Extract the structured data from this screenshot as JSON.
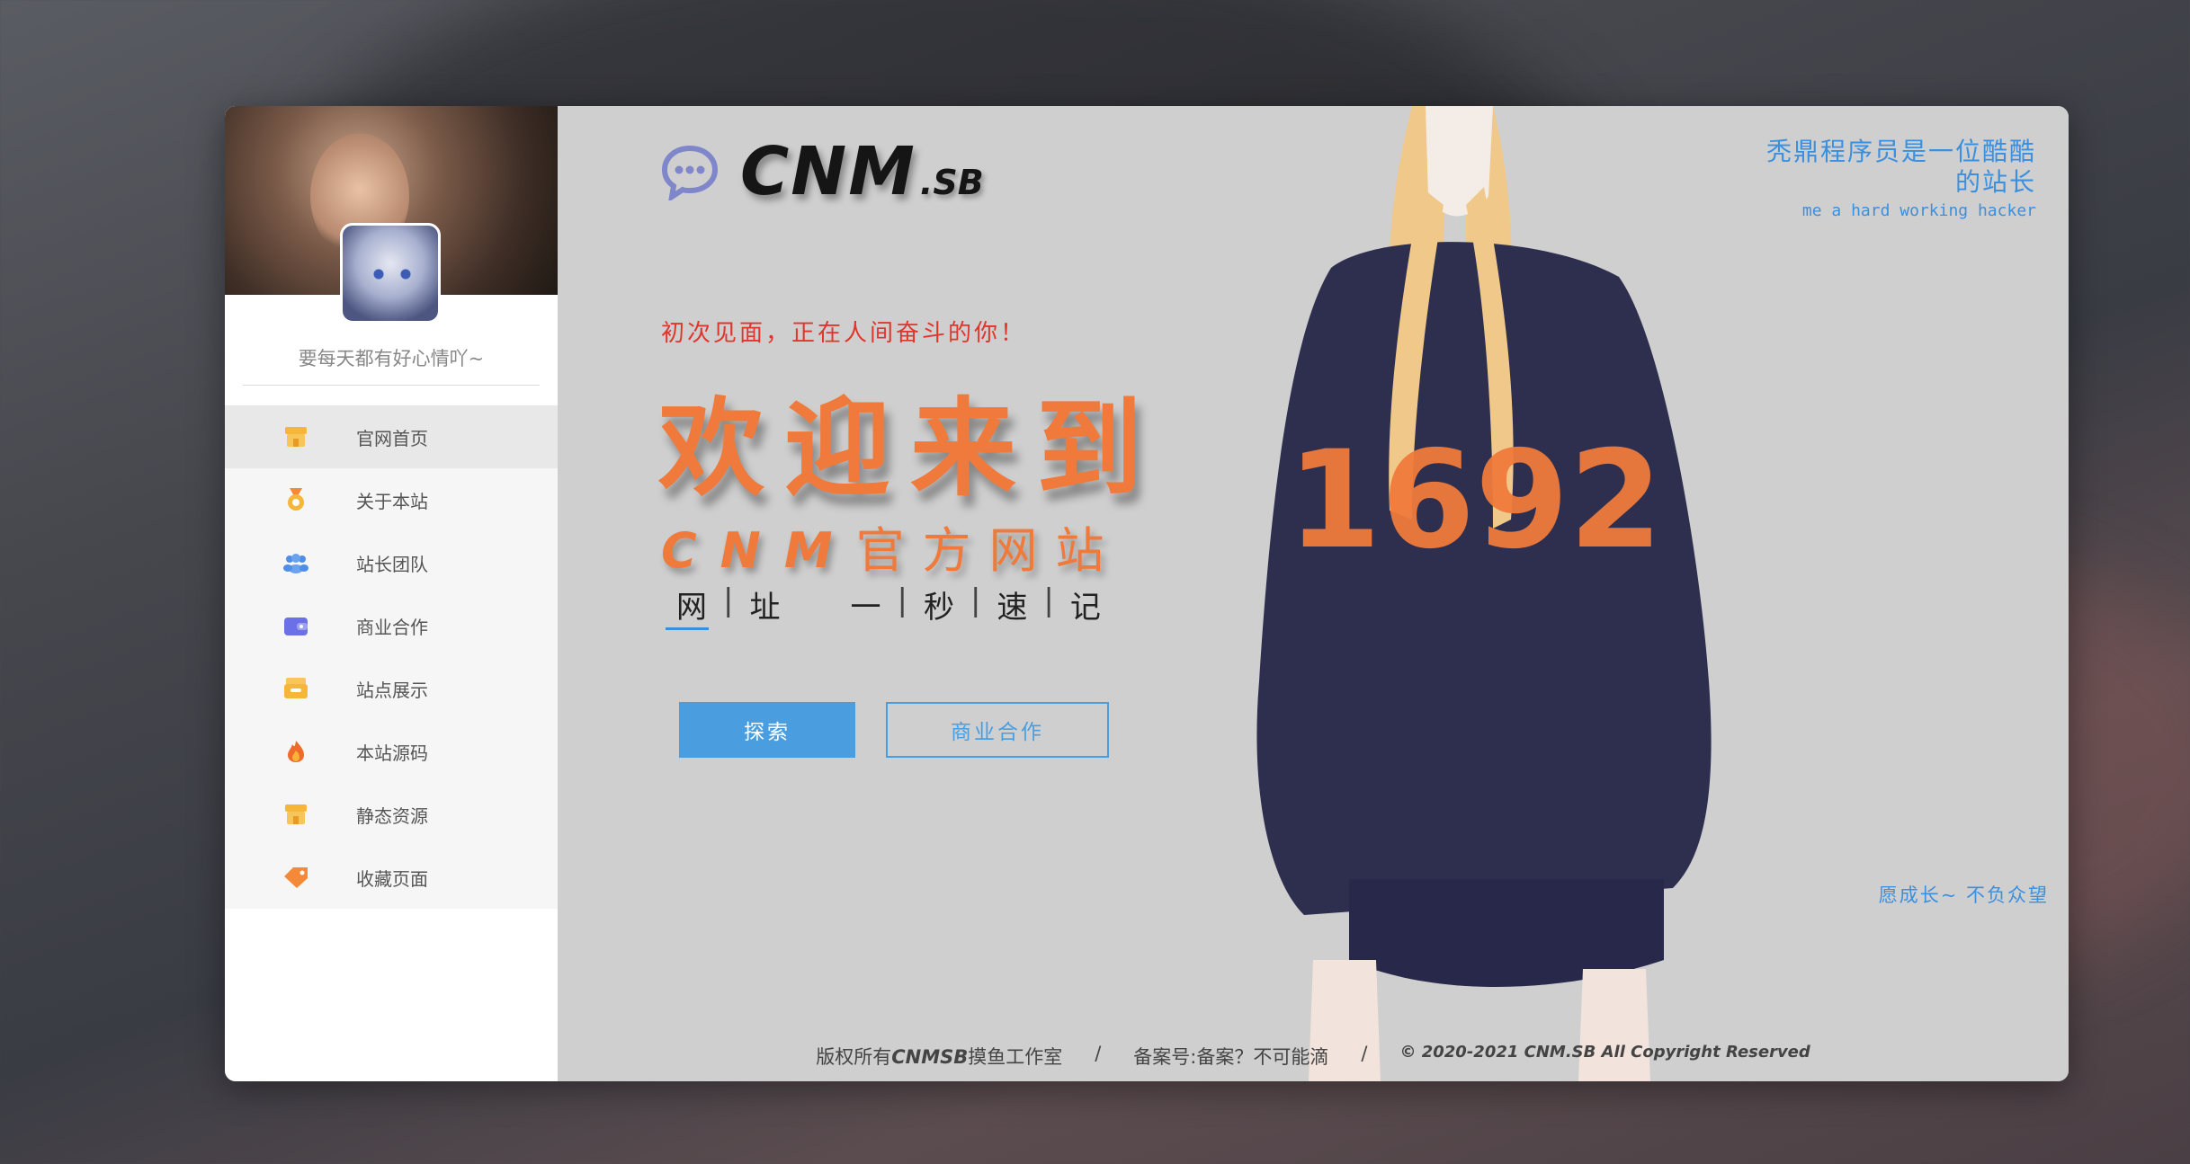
{
  "sidebar": {
    "motto": "要每天都有好心情吖~",
    "items": [
      {
        "label": "官网首页",
        "icon": "shop-icon",
        "color": "#f5b63a",
        "active": true
      },
      {
        "label": "关于本站",
        "icon": "medal-icon",
        "color": "#f5a23a"
      },
      {
        "label": "站长团队",
        "icon": "team-icon",
        "color": "#4f8de6"
      },
      {
        "label": "商业合作",
        "icon": "wallet-icon",
        "color": "#6b6fe8"
      },
      {
        "label": "站点展示",
        "icon": "inbox-icon",
        "color": "#f5b63a"
      },
      {
        "label": "本站源码",
        "icon": "fire-icon",
        "color": "#f06a2a"
      },
      {
        "label": "静态资源",
        "icon": "shop-icon",
        "color": "#f5b63a"
      },
      {
        "label": "收藏页面",
        "icon": "tag-icon",
        "color": "#f5893a"
      }
    ]
  },
  "header": {
    "logo_text": "CNM",
    "logo_sub": ".SB",
    "tagline_cn": "秃鼎程序员是一位酷酷的站长",
    "tagline_en": "me a hard working hacker"
  },
  "hero": {
    "greeting": "初次见面，正在人间奋斗的你！",
    "welcome": "欢迎来到",
    "site_prefix": "CNM",
    "site_suffix": "官方网站",
    "url_chars": [
      "网",
      "址",
      "一",
      "秒",
      "速",
      "记"
    ],
    "primary_button": "探索",
    "secondary_button": "商业合作",
    "slogan": "愿成长~ 不负众望",
    "shirt_number": "1692"
  },
  "footer": {
    "copyright_prefix": "版权所有",
    "copyright_brand": "CNMSB",
    "copyright_suffix": "摸鱼工作室",
    "sep": "/",
    "icp": "备案号:备案？不可能滴",
    "rights": "© 2020-2021 CNM.SB All Copyright Reserved"
  },
  "colors": {
    "accent": "#4a9ee0",
    "orange": "#ef7a3b",
    "red_text": "#e0352b"
  }
}
